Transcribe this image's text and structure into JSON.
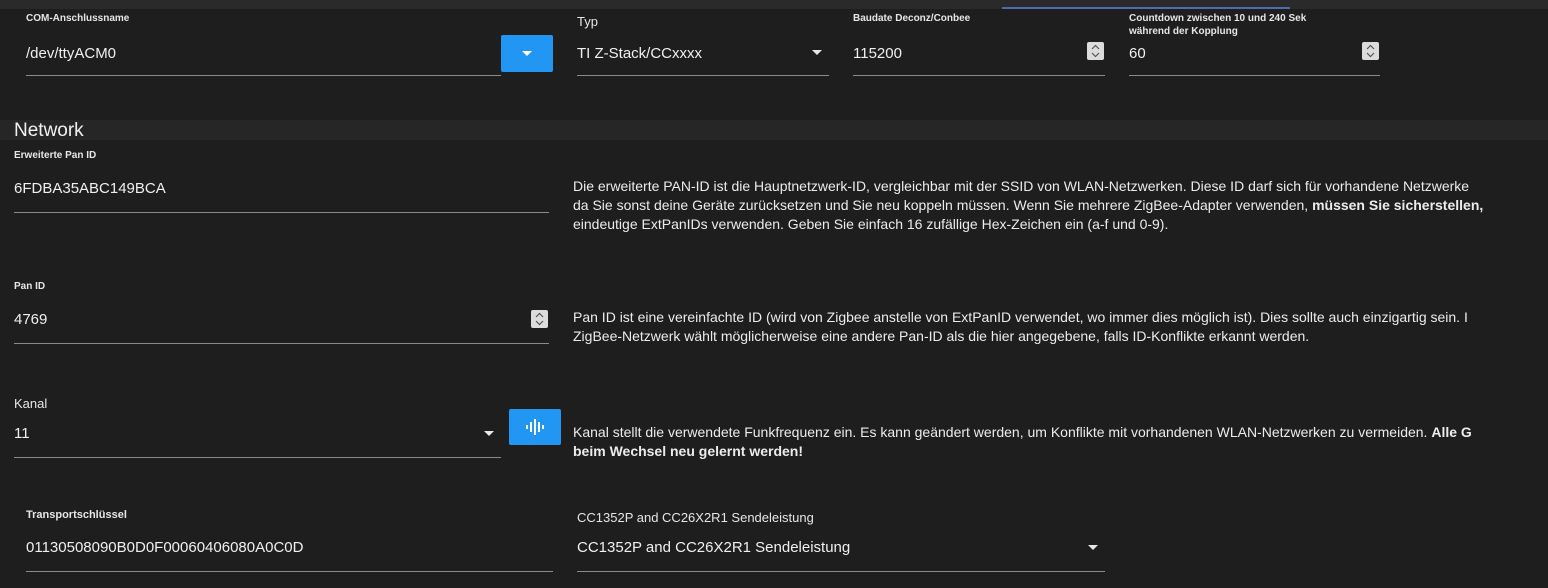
{
  "colors": {
    "background": "#1e1e1e",
    "accent": "#2196f3",
    "underline": "#8a8a8a"
  },
  "row1": {
    "com_label": "COM-Anschlussname",
    "com_value": "/dev/ttyACM0",
    "type_label": "Typ",
    "type_value": "TI Z-Stack/CCxxxx",
    "baud_label": "Baudate Deconz/Conbee",
    "baud_value": "115200",
    "countdown_label_line1": "Countdown zwischen 10 und 240 Sek",
    "countdown_label_line2": "während der Kopplung",
    "countdown_value": "60"
  },
  "network": {
    "title": "Network",
    "ext_pan_label": "Erweiterte Pan ID",
    "ext_pan_value": "6FDBA35ABC149BCA",
    "ext_pan_desc_line1": "Die erweiterte PAN-ID ist die Hauptnetzwerk-ID, vergleichbar mit der SSID von WLAN-Netzwerken. Diese ID darf sich für vorhandene Netzwerke",
    "ext_pan_desc_line2a": "da Sie sonst deine Geräte zurücksetzen und Sie neu koppeln müssen. Wenn Sie mehrere ZigBee-Adapter verwenden, ",
    "ext_pan_desc_line2b": "müssen Sie sicherstellen,",
    "ext_pan_desc_line3": "eindeutige ExtPanIDs verwenden. Geben Sie einfach 16 zufällige Hex-Zeichen ein (a-f und 0-9).",
    "pan_label": "Pan ID",
    "pan_value": "4769",
    "pan_desc_line1": "Pan ID ist eine vereinfachte ID (wird von Zigbee anstelle von ExtPanID verwendet, wo immer dies möglich ist). Dies sollte auch einzigartig sein. I",
    "pan_desc_line2": "ZigBee-Netzwerk wählt möglicherweise eine andere Pan-ID als die hier angegebene, falls ID-Konflikte erkannt werden.",
    "channel_label": "Kanal",
    "channel_value": "11",
    "channel_desc_line1a": "Kanal stellt die verwendete Funkfrequenz ein. Es kann geändert werden, um Konflikte mit vorhandenen WLAN-Netzwerken zu vermeiden. ",
    "channel_desc_line1b": "Alle G",
    "channel_desc_line2": "beim Wechsel neu gelernt werden!",
    "transport_label": "Transportschlüssel",
    "transport_value": "01130508090B0D0F00060406080A0C0D",
    "power_label": "CC1352P and CC26X2R1 Sendeleistung",
    "power_value": "CC1352P and CC26X2R1 Sendeleistung"
  },
  "icons": {
    "com_dropdown": "caret-down-icon",
    "scan": "audio-wave-icon",
    "spinner": "up-down-spinner-icon"
  }
}
